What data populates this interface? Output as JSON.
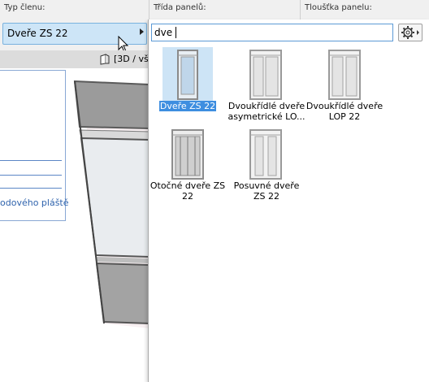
{
  "header": {
    "col1_label": "Typ členu:",
    "col2_label": "Třída panelů:",
    "col3_label": "Tloušťka panelu:"
  },
  "member_type": {
    "selected": "Dveře ZS 22"
  },
  "view": {
    "label": "[3D / vš"
  },
  "left_panel": {
    "partial_text": "odového pláště"
  },
  "search": {
    "value": "dve"
  },
  "results": [
    {
      "label_line1": "Dveře ZS 22",
      "label_line2": "",
      "selected": true
    },
    {
      "label_line1": "Dvoukřídlé dveře",
      "label_line2": "asymetrické LO...",
      "selected": false
    },
    {
      "label_line1": "Dvoukřídlé dveře",
      "label_line2": "LOP 22",
      "selected": false
    },
    {
      "label_line1": "Otočné dveře ZS",
      "label_line2": "22",
      "selected": false
    },
    {
      "label_line1": "Posuvné dveře",
      "label_line2": "ZS 22",
      "selected": false
    }
  ],
  "colors": {
    "selection_bg": "#cde4f6",
    "selection_label": "#3e8ee0",
    "accent_border": "#5c9ad6",
    "link_blue": "#2f63ad"
  }
}
